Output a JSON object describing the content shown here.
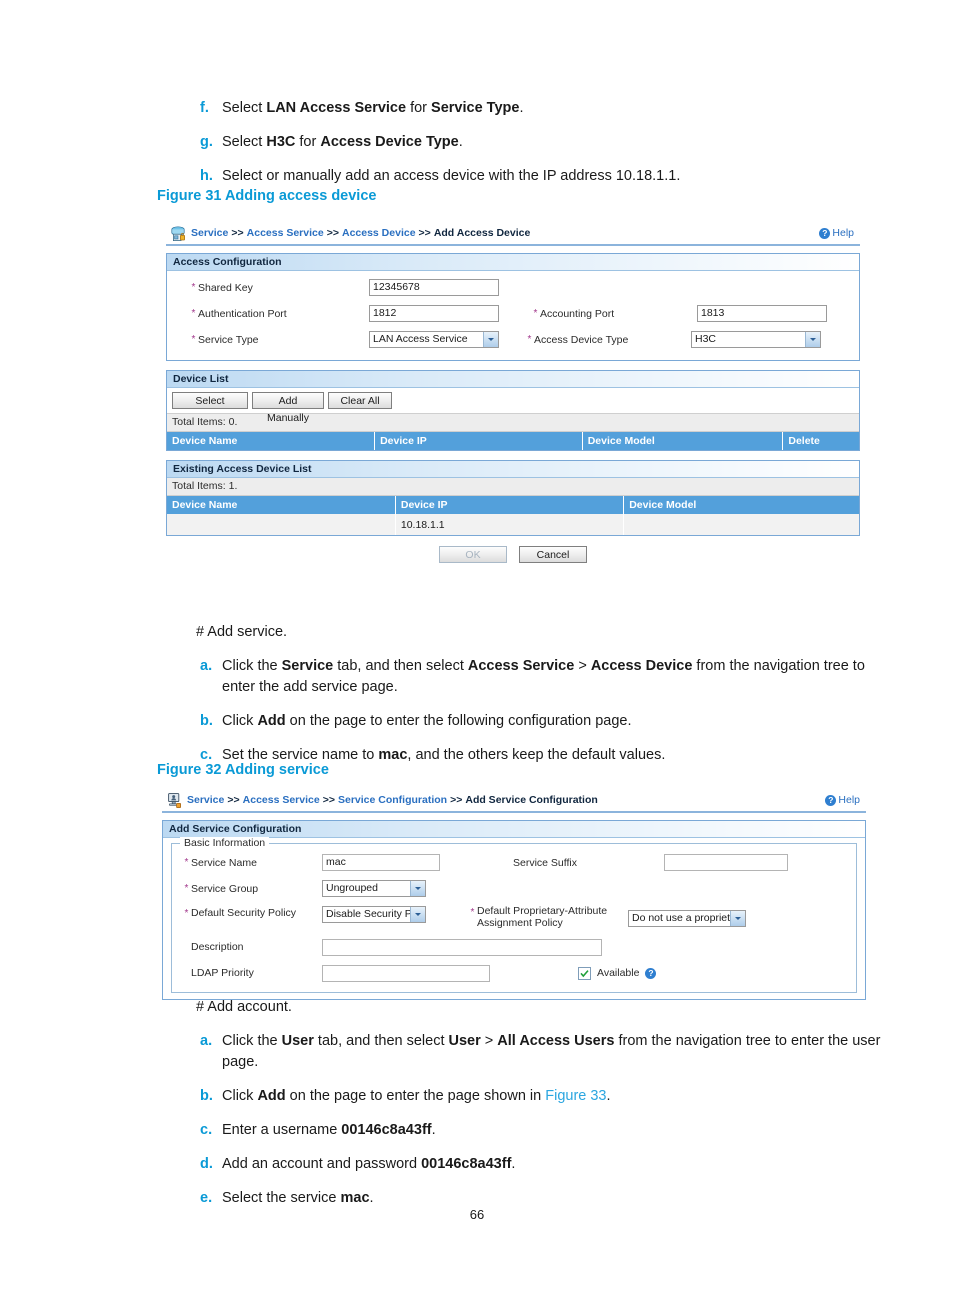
{
  "page": {
    "number": "66"
  },
  "intro_steps": [
    {
      "marker": "f.",
      "html": "Select <b>LAN Access Service</b> for <b>Service Type</b>."
    },
    {
      "marker": "g.",
      "html": "Select <b>H3C</b> for <b>Access Device Type</b>."
    },
    {
      "marker": "h.",
      "html": "Select or manually add an access device with the IP address 10.18.1.1."
    }
  ],
  "figure31": {
    "caption": "Figure 31 Adding access device",
    "header": {
      "icon": "access-device-icon",
      "breadcrumb": [
        "Service",
        "Access Service",
        "Access Device",
        "Add Access Device"
      ],
      "separator": ">>",
      "help_label": "Help",
      "help_icon": "question-mark-icon"
    },
    "access_configuration": {
      "title": "Access Configuration",
      "shared_key": {
        "label": "Shared Key",
        "value": "12345678",
        "required": true
      },
      "authentication_port": {
        "label": "Authentication Port",
        "value": "1812",
        "required": true
      },
      "accounting_port": {
        "label": "Accounting Port",
        "value": "1813",
        "required": true
      },
      "service_type": {
        "label": "Service Type",
        "value": "LAN Access Service",
        "required": true
      },
      "access_device_type": {
        "label": "Access Device Type",
        "value": "H3C",
        "required": true
      }
    },
    "device_list": {
      "title": "Device List",
      "buttons": {
        "select": "Select",
        "add_manually": "Add Manually",
        "clear_all": "Clear All"
      },
      "total_items": "Total Items: 0.",
      "columns": [
        "Device Name",
        "Device IP",
        "Device Model",
        "Delete"
      ],
      "rows": []
    },
    "existing_device_list": {
      "title": "Existing Access Device List",
      "total_items": "Total Items: 1.",
      "columns": [
        "Device Name",
        "Device IP",
        "Device Model"
      ],
      "rows": [
        {
          "device_name": "",
          "device_ip": "10.18.1.1",
          "device_model": ""
        }
      ]
    },
    "actions": {
      "ok": "OK",
      "cancel": "Cancel",
      "ok_disabled": true
    }
  },
  "mid_steps": {
    "heading": "# Add service.",
    "items": [
      {
        "marker": "a.",
        "html": "Click the <b>Service</b> tab, and then select <b>Access Service</b> &gt; <b>Access Device</b> from the navigation tree to enter the add service page."
      },
      {
        "marker": "b.",
        "html": "Click <b>Add</b> on the page to enter the following configuration page."
      },
      {
        "marker": "c.",
        "html": "Set the service name to <b>mac</b>, and the others keep the default values."
      }
    ]
  },
  "figure32": {
    "caption": "Figure 32 Adding service",
    "header": {
      "icon": "service-configuration-icon",
      "breadcrumb": [
        "Service",
        "Access Service",
        "Service Configuration",
        "Add Service Configuration"
      ],
      "separator": ">>",
      "help_label": "Help",
      "help_icon": "question-mark-icon"
    },
    "panel_title": "Add Service Configuration",
    "group_legend": "Basic Information",
    "fields": {
      "service_name": {
        "label": "Service Name",
        "value": "mac",
        "required": true
      },
      "service_suffix": {
        "label": "Service Suffix",
        "value": "",
        "required": false
      },
      "service_group": {
        "label": "Service Group",
        "value": "Ungrouped",
        "required": true
      },
      "default_security_policy": {
        "label": "Default Security Policy",
        "value": "Disable Security Policy",
        "required": true
      },
      "default_proprietary_policy": {
        "label": "Default Proprietary-Attribute Assignment Policy",
        "label_line1": "Default Proprietary-Attribute",
        "label_line2": "Assignment Policy",
        "value": "Do not use a proprietar",
        "required": true
      },
      "description": {
        "label": "Description",
        "value": "",
        "required": false
      },
      "ldap_priority": {
        "label": "LDAP Priority",
        "value": "",
        "required": false
      },
      "available": {
        "label": "Available",
        "checked": true,
        "help_icon": "question-mark-icon"
      }
    }
  },
  "end_steps": {
    "heading": "# Add account.",
    "items": [
      {
        "marker": "a.",
        "html": "Click the <b>User</b> tab, and then select <b>User</b> &gt; <b>All Access Users</b> from the navigation tree to enter the user page."
      },
      {
        "marker": "b.",
        "html": "Click <b>Add</b> on the page to enter the page shown in <span class=\"lnk\">Figure 33</span>."
      },
      {
        "marker": "c.",
        "html": "Enter a username <b>00146c8a43ff</b>."
      },
      {
        "marker": "d.",
        "html": "Add an account and password <b>00146c8a43ff</b>."
      },
      {
        "marker": "e.",
        "html": "Select the service <b>mac</b>."
      }
    ]
  },
  "colors": {
    "heading_blue": "#0a9ad6",
    "table_header_blue": "#53a0db",
    "crumb_link": "#2a6fc0",
    "required_star": "#a0348a"
  }
}
